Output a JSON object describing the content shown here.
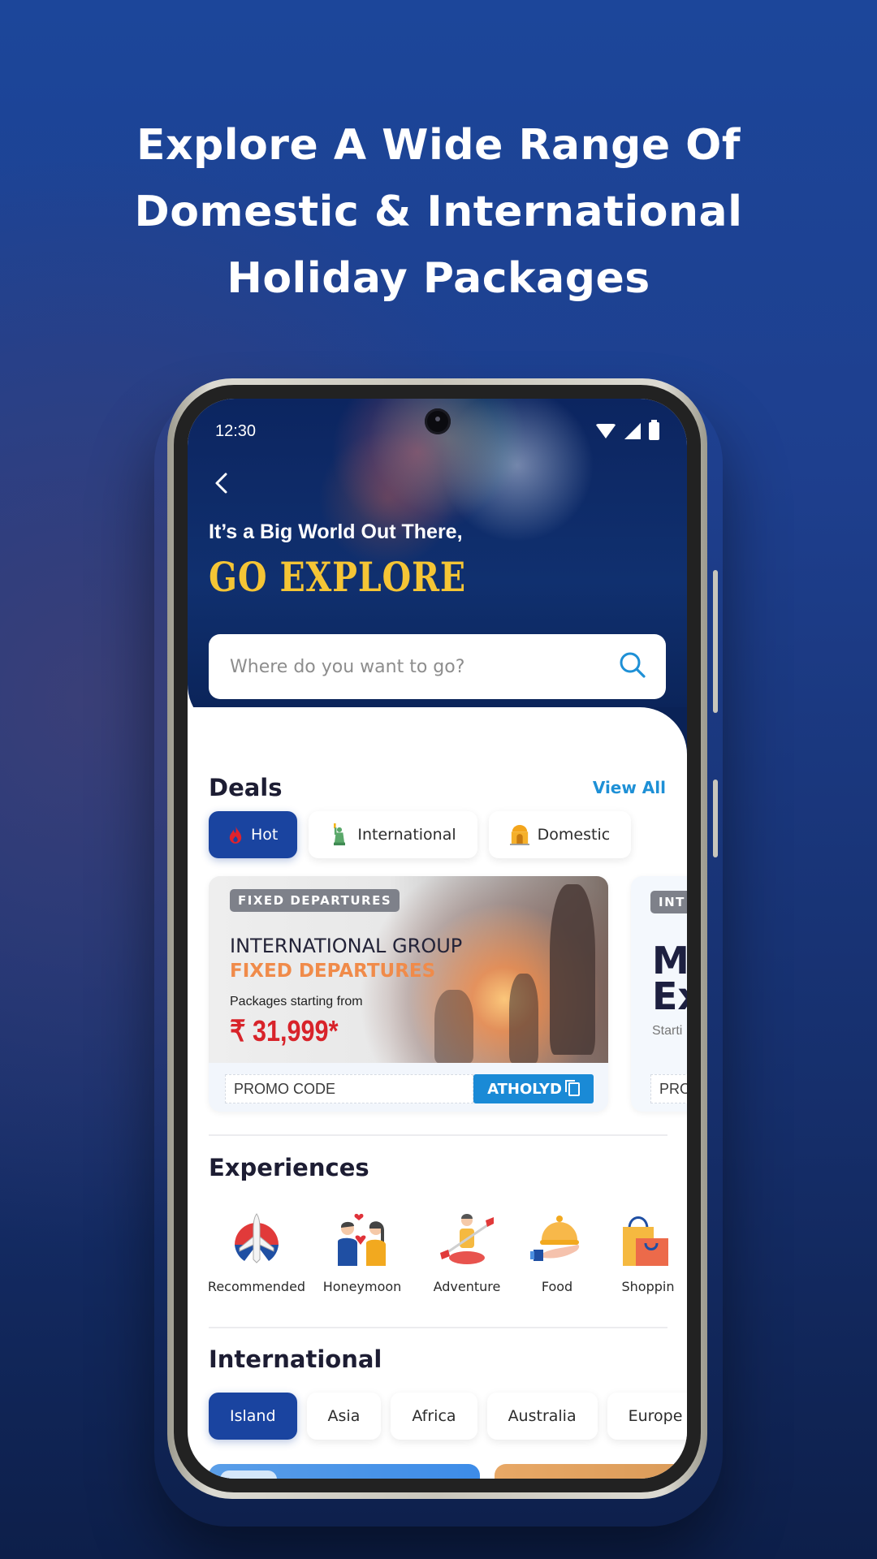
{
  "headline": {
    "lines": [
      "Explore A Wide Range Of",
      "Domestic & International",
      "Holiday Packages"
    ]
  },
  "status_bar": {
    "time": "12:30",
    "icons": [
      "wifi-icon",
      "signal-icon",
      "battery-icon"
    ]
  },
  "hero": {
    "back_icon": "chevron-left-icon",
    "subtitle": "It’s a Big World Out There,",
    "title": "GO EXPLORE",
    "search": {
      "placeholder": "Where do you want to go?",
      "value": "",
      "icon": "search-icon"
    }
  },
  "deals": {
    "title": "Deals",
    "view_all": "View All",
    "tabs": [
      {
        "label": "Hot",
        "icon": "flame-icon",
        "active": true
      },
      {
        "label": "International",
        "icon": "statue-of-liberty-icon",
        "active": false
      },
      {
        "label": "Domestic",
        "icon": "india-gate-icon",
        "active": false
      }
    ],
    "cards": [
      {
        "tag": "FIXED DEPARTURES",
        "line1": "INTERNATIONAL GROUP",
        "line2": "FIXED DEPARTURES",
        "line3": "Packages starting from",
        "price": "₹ 31,999*",
        "promo_label": "PROMO CODE",
        "promo_code": "ATHOLYD"
      },
      {
        "tag": "INT",
        "title_line1": "M",
        "title_line2": "Ex",
        "sub": "Starti",
        "promo_label": "PRO"
      }
    ]
  },
  "experiences": {
    "title": "Experiences",
    "items": [
      {
        "label": "Recommended",
        "icon": "airplane-icon"
      },
      {
        "label": "Honeymoon",
        "icon": "couple-heart-icon"
      },
      {
        "label": "Adventure",
        "icon": "kayak-icon"
      },
      {
        "label": "Food",
        "icon": "food-cloche-icon"
      },
      {
        "label": "Shoppin",
        "icon": "shopping-bag-icon"
      }
    ]
  },
  "international": {
    "title": "International",
    "tabs": [
      {
        "label": "Island",
        "active": true
      },
      {
        "label": "Asia",
        "active": false
      },
      {
        "label": "Africa",
        "active": false
      },
      {
        "label": "Australia",
        "active": false
      },
      {
        "label": "Europe",
        "active": false
      }
    ]
  },
  "colors": {
    "primary": "#1a44a0",
    "accent": "#1e90d6",
    "title_yellow": "#f5c535",
    "price_red": "#d8232a",
    "deal_orange": "#f08b4a"
  }
}
